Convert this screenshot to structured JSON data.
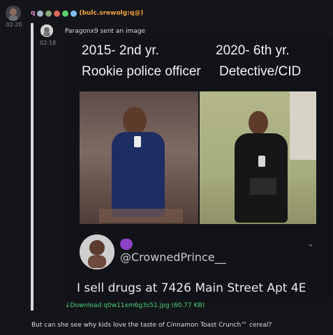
{
  "message": {
    "time": "02:20",
    "username": "q",
    "hostname": "(bulc.srewolg:q@)",
    "text": "But can she see why kids love the taste of Cinnamon Toast Crunch™ cereal?"
  },
  "reply": {
    "time": "02:18",
    "text": "Paragonx9 sent an image"
  },
  "image": {
    "caption_left_line1": "2015- 2nd yr.",
    "caption_left_line2": "Rookie police officer",
    "caption_right_line1": "2020- 6th yr.",
    "caption_right_line2": "Detective/CID",
    "tweet_handle": "@CrownedPrince__",
    "tweet_text": "I sell drugs at 7426 Main Street Apt 4E",
    "download_text": "↓Download q0w11xm6g3s51.jpg (60.77 KB)"
  },
  "colors": {
    "background": "#141519",
    "username": "#e88ad8",
    "hostname": "#f0a33a",
    "download": "#4bd17a"
  },
  "icons": {
    "chevron": "⌄",
    "emoji": "devil-emoji"
  }
}
